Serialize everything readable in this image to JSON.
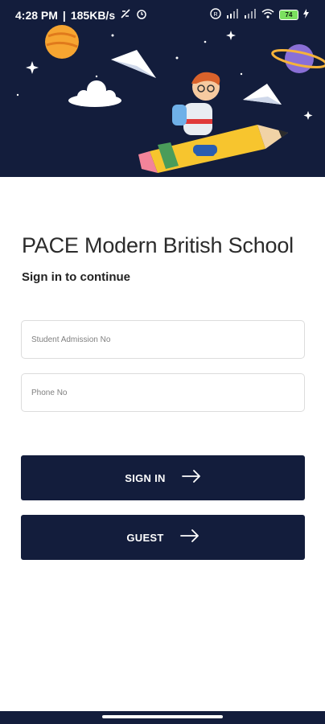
{
  "status_bar": {
    "time": "4:28 PM",
    "speed": "185KB/s",
    "battery_level": "74"
  },
  "app": {
    "school_name": "PACE Modern British School",
    "subtitle": "Sign in to continue"
  },
  "form": {
    "admission_placeholder": "Student Admission No",
    "phone_placeholder": "Phone No"
  },
  "buttons": {
    "sign_in_label": "SIGN IN",
    "guest_label": "GUEST"
  },
  "colors": {
    "primary": "#131d3c",
    "background": "#ffffff",
    "battery": "#7be05f"
  },
  "icons": [
    "arrow-right-icon",
    "alarm-icon",
    "wifi-icon",
    "signal-icon",
    "planet-icon",
    "paper-plane-icon",
    "cloud-icon",
    "star-icon"
  ]
}
